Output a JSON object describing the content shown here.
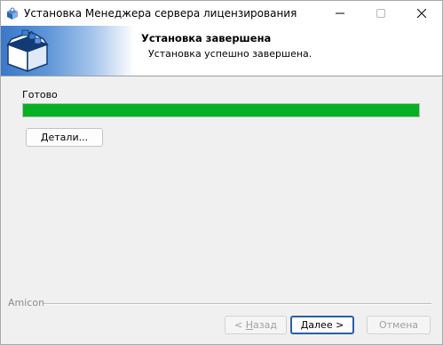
{
  "window": {
    "title": "Установка Менеджера сервера лицензирования"
  },
  "header": {
    "title": "Установка завершена",
    "subtitle": "Установка успешно завершена."
  },
  "main": {
    "status_label": "Готово",
    "progress_fraction": 1.0,
    "progress_color": "#06b025",
    "details_label": "Детали..."
  },
  "footer": {
    "brand": "Amicon",
    "back": {
      "prefix": "< ",
      "hotkey": "Н",
      "rest": "азад"
    },
    "next": {
      "hotkey": "Д",
      "rest": "алее >"
    },
    "cancel_label": "Отмена"
  },
  "icons": {
    "app": "installer-box-icon",
    "banner": "open-box-icon",
    "minimize": "minimize-icon",
    "maximize": "maximize-icon",
    "close": "close-icon"
  }
}
